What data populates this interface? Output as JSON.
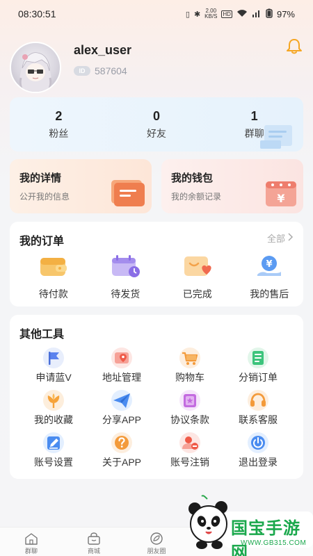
{
  "status_bar": {
    "time": "08:30:51",
    "net_speed_top": "2.00",
    "net_speed_bottom": "KB/S",
    "hd_label": "HD",
    "battery": "97%"
  },
  "profile": {
    "username": "alex_user",
    "uid_badge": "ID",
    "uid": "587604"
  },
  "stats": [
    {
      "value": "2",
      "label": "粉丝"
    },
    {
      "value": "0",
      "label": "好友"
    },
    {
      "value": "1",
      "label": "群聊"
    }
  ],
  "features": {
    "details": {
      "title": "我的详情",
      "subtitle": "公开我的信息"
    },
    "wallet": {
      "title": "我的钱包",
      "subtitle": "我的余额记录",
      "icon_char": "¥"
    }
  },
  "orders": {
    "title": "我的订单",
    "see_all": "全部",
    "money_symbol": "¥",
    "items": [
      {
        "label": "待付款",
        "icon": "wallet-icon"
      },
      {
        "label": "待发货",
        "icon": "calendar-clock-icon"
      },
      {
        "label": "已完成",
        "icon": "heart-box-icon"
      },
      {
        "label": "我的售后",
        "icon": "yen-hand-icon"
      }
    ]
  },
  "tools": {
    "title": "其他工具",
    "items": [
      {
        "label": "申请蓝V",
        "icon": "flag-icon"
      },
      {
        "label": "地址管理",
        "icon": "map-pin-icon"
      },
      {
        "label": "购物车",
        "icon": "cart-icon"
      },
      {
        "label": "分销订单",
        "icon": "document-icon"
      },
      {
        "label": "我的收藏",
        "icon": "flower-icon"
      },
      {
        "label": "分享APP",
        "icon": "paper-plane-icon"
      },
      {
        "label": "协议条款",
        "icon": "book-icon"
      },
      {
        "label": "联系客服",
        "icon": "headset-icon"
      },
      {
        "label": "账号设置",
        "icon": "edit-icon"
      },
      {
        "label": "关于APP",
        "icon": "question-icon"
      },
      {
        "label": "账号注销",
        "icon": "user-remove-icon"
      },
      {
        "label": "退出登录",
        "icon": "power-icon"
      }
    ]
  },
  "bottom_nav": [
    {
      "label": "群聊",
      "icon": "home-icon"
    },
    {
      "label": "商城",
      "icon": "bag-icon"
    },
    {
      "label": "朋友圈",
      "icon": "leaf-icon"
    }
  ],
  "watermark": {
    "title": "国宝手游网",
    "subtitle": "WWW.GB315.COM"
  },
  "colors": {
    "accent_orange": "#f5a623",
    "blue_icon": "#4a8cf0",
    "red_icon": "#f05a4a",
    "green_icon": "#3cc47c",
    "watermark_green": "#1aa84c"
  }
}
